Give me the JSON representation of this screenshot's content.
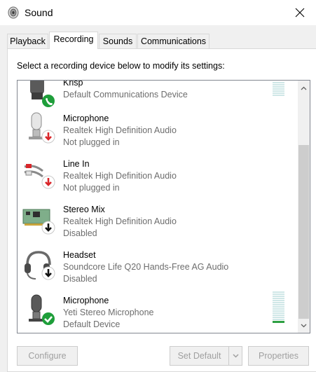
{
  "window": {
    "title": "Sound",
    "close_label": "✕"
  },
  "tabs": [
    {
      "label": "Playback",
      "active": false
    },
    {
      "label": "Recording",
      "active": true
    },
    {
      "label": "Sounds",
      "active": false
    },
    {
      "label": "Communications",
      "active": false
    }
  ],
  "instruction": "Select a recording device below to modify its settings:",
  "devices": [
    {
      "name": "Krisp",
      "desc": "Default Communications Device",
      "status": "",
      "icon": "phone-headset-icon",
      "badge": "green-phone-badge",
      "level": 0
    },
    {
      "name": "Microphone",
      "desc": "Realtek High Definition Audio",
      "status": "Not plugged in",
      "icon": "microphone-icon",
      "badge": "red-down-arrow-badge",
      "level": 0
    },
    {
      "name": "Line In",
      "desc": "Realtek High Definition Audio",
      "status": "Not plugged in",
      "icon": "rca-cable-icon",
      "badge": "red-down-arrow-badge",
      "level": 0
    },
    {
      "name": "Stereo Mix",
      "desc": "Realtek High Definition Audio",
      "status": "Disabled",
      "icon": "sound-card-icon",
      "badge": "black-down-arrow-badge",
      "level": 0
    },
    {
      "name": "Headset",
      "desc": "Soundcore Life Q20 Hands-Free AG Audio",
      "status": "Disabled",
      "icon": "headset-icon",
      "badge": "black-down-arrow-badge",
      "level": 0
    },
    {
      "name": "Microphone",
      "desc": "Yeti Stereo Microphone",
      "status": "Default Device",
      "icon": "microphone-icon",
      "badge": "green-check-badge",
      "level": 0.06
    }
  ],
  "buttons": {
    "configure": "Configure",
    "set_default": "Set Default",
    "properties": "Properties"
  },
  "colors": {
    "green_badge": "#1e9e3a",
    "red_badge": "#d9262a",
    "vu_empty": "#cfe7e7",
    "vu_active": "#2ea043"
  }
}
